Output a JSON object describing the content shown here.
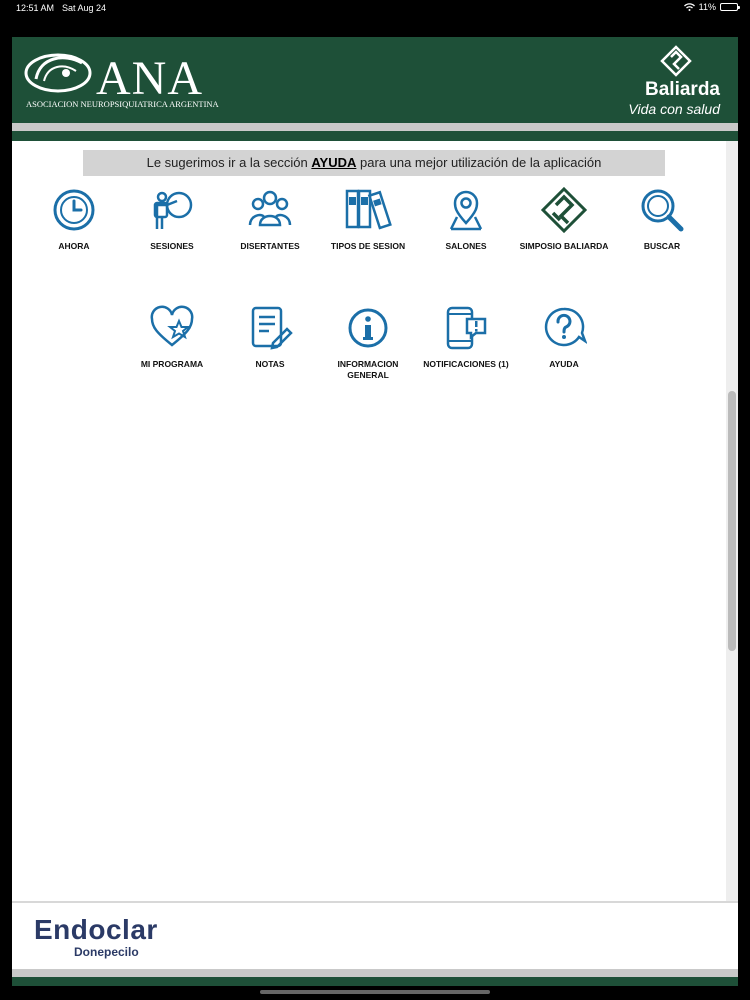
{
  "status_bar": {
    "time": "12:51 AM",
    "date": "Sat Aug 24",
    "battery": "11%",
    "battery_level": 0.11
  },
  "header": {
    "logo_text": "ANA",
    "logo_subtitle": "ASOCIACION NEUROPSIQUIATRICA ARGENTINA",
    "sponsor_name": "Baliarda",
    "sponsor_tagline": "Vida con salud"
  },
  "hint": {
    "prefix": "Le sugerimos ir a la sección ",
    "link": "AYUDA",
    "suffix": " para una mejor utilización de la aplicación"
  },
  "menu": [
    {
      "label": "AHORA",
      "icon": "clock-icon"
    },
    {
      "label": "SESIONES",
      "icon": "presenter-icon"
    },
    {
      "label": "DISERTANTES",
      "icon": "people-icon"
    },
    {
      "label": "TIPOS DE SESION",
      "icon": "books-icon"
    },
    {
      "label": "SALONES",
      "icon": "map-pin-icon"
    },
    {
      "label": "SIMPOSIO BALIARDA",
      "icon": "baliarda-icon"
    },
    {
      "label": "BUSCAR",
      "icon": "search-icon"
    },
    {
      "label": "MI PROGRAMA",
      "icon": "heart-star-icon"
    },
    {
      "label": "NOTAS",
      "icon": "notes-icon"
    },
    {
      "label": "INFORMACION GENERAL",
      "icon": "info-icon"
    },
    {
      "label": "NOTIFICACIONES (1)",
      "icon": "notification-icon"
    },
    {
      "label": "AYUDA",
      "icon": "help-icon"
    }
  ],
  "footer": {
    "brand": "Endoclar",
    "subtitle": "Donepecilo"
  },
  "colors": {
    "brand_green": "#1e5038",
    "icon_blue": "#1b6fa8"
  }
}
